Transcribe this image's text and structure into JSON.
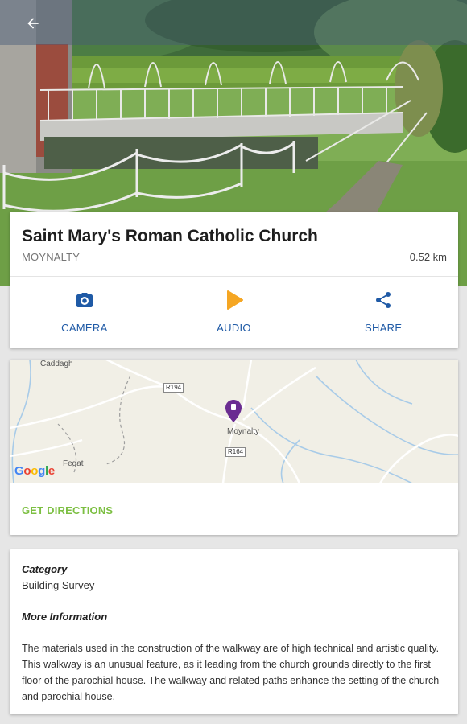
{
  "appbar": {
    "back_icon": "arrow-back-icon"
  },
  "poi": {
    "title": "Saint Mary's Roman Catholic Church",
    "location": "MOYNALTY",
    "distance": "0.52 km"
  },
  "actions": [
    {
      "label": "CAMERA",
      "icon": "camera-icon",
      "color": "#1f5aa6"
    },
    {
      "label": "AUDIO",
      "icon": "play-icon",
      "color": "#f5a623"
    },
    {
      "label": "SHARE",
      "icon": "share-icon",
      "color": "#1f5aa6"
    }
  ],
  "map": {
    "labels": {
      "caddagh": "Caddagh",
      "moynalty": "Moynalty",
      "fegat": "Fegat",
      "road_r194": "R194",
      "road_r164": "R164"
    },
    "logo": "Google",
    "marker_color": "#6a2c91",
    "directions_label": "GET DIRECTIONS",
    "directions_color": "#7cbf42"
  },
  "info": {
    "category_heading": "Category",
    "category_value": "Building Survey",
    "more_heading": "More Information",
    "description": "The materials used in the construction of the walkway are of high technical and artistic quality. This walkway is an unusual feature, as it leading from the church grounds directly to the first floor of the parochial house. The walkway and related paths enhance the setting of the church and parochial house."
  }
}
